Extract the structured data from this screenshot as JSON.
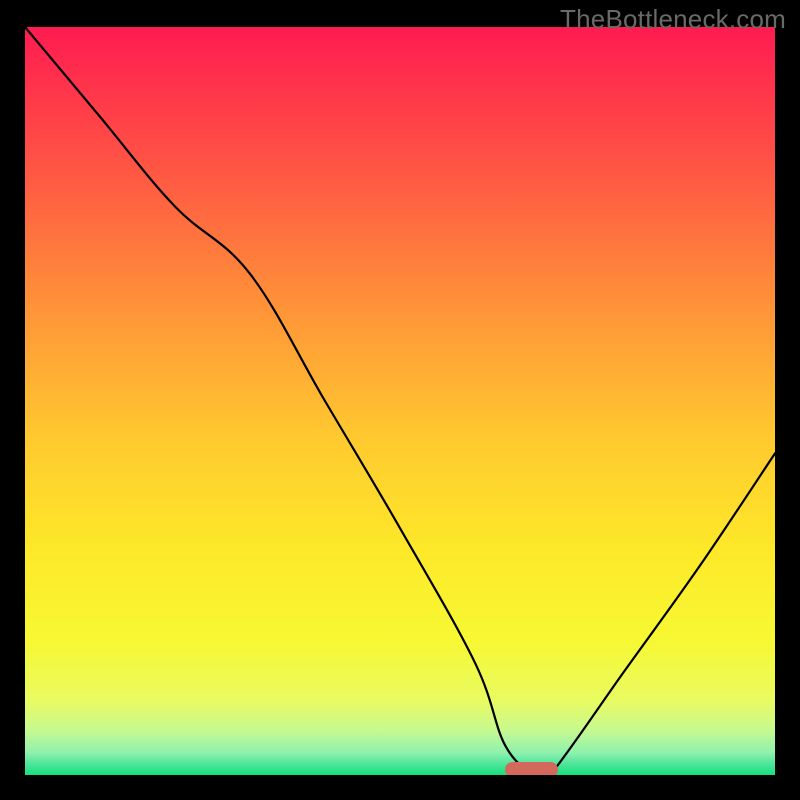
{
  "watermark": "TheBottleneck.com",
  "chart_data": {
    "type": "line",
    "title": "",
    "xlabel": "",
    "ylabel": "",
    "xlim": [
      0,
      100
    ],
    "ylim": [
      0,
      100
    ],
    "grid": false,
    "series": [
      {
        "name": "bottleneck-curve",
        "x": [
          0,
          10,
          20,
          30,
          40,
          50,
          60,
          64,
          68,
          70,
          80,
          90,
          100
        ],
        "values": [
          100,
          88,
          76,
          67,
          50,
          33,
          15,
          4,
          0,
          0,
          14,
          28,
          43
        ]
      }
    ],
    "annotations": [
      {
        "type": "optimum-marker",
        "x_range": [
          64,
          71
        ],
        "y": 0
      }
    ],
    "background_gradient": {
      "stops": [
        {
          "offset": 0.0,
          "color": "#ff1b51"
        },
        {
          "offset": 0.2,
          "color": "#ff5943"
        },
        {
          "offset": 0.4,
          "color": "#ff9b37"
        },
        {
          "offset": 0.55,
          "color": "#ffc92f"
        },
        {
          "offset": 0.7,
          "color": "#fde929"
        },
        {
          "offset": 0.82,
          "color": "#f7f833"
        },
        {
          "offset": 0.9,
          "color": "#e9fb61"
        },
        {
          "offset": 0.94,
          "color": "#c7f98f"
        },
        {
          "offset": 0.97,
          "color": "#8ff1ae"
        },
        {
          "offset": 0.985,
          "color": "#4fe69a"
        },
        {
          "offset": 1.0,
          "color": "#17de7d"
        }
      ]
    },
    "optimum_marker_color": "#d3695d"
  }
}
